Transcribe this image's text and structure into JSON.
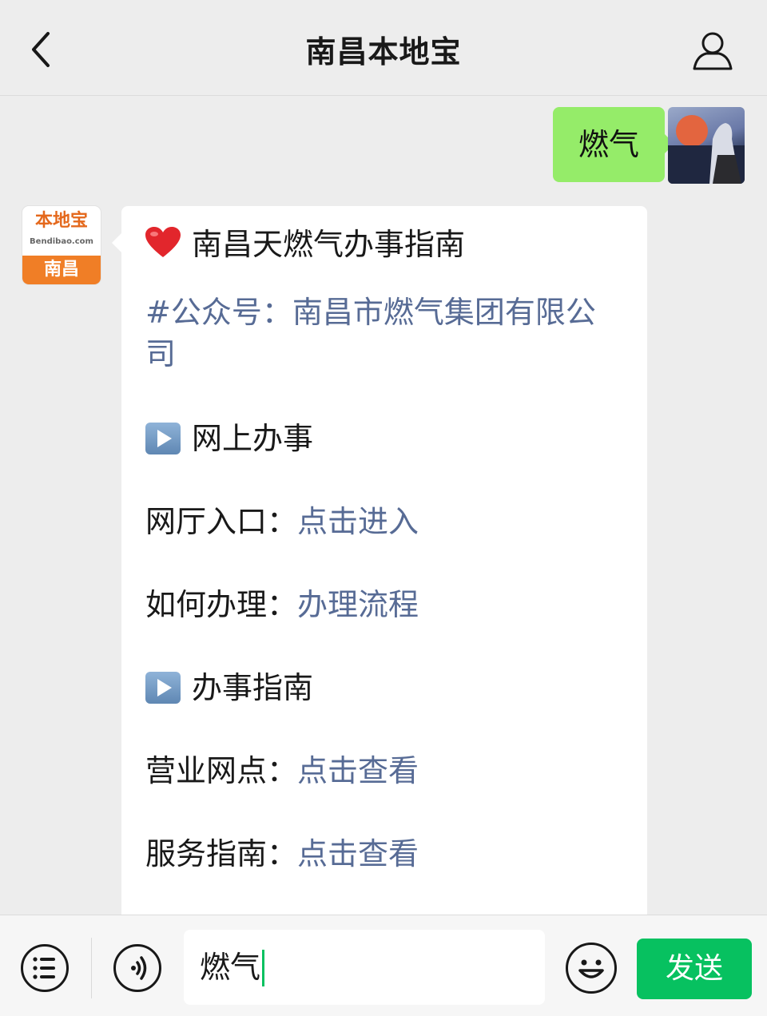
{
  "header": {
    "title": "南昌本地宝"
  },
  "outgoing_message": {
    "text": "燃气"
  },
  "bot_avatar": {
    "brand": "本地宝",
    "domain": "Bendibao.com",
    "city": "南昌"
  },
  "card": {
    "title": "南昌天燃气办事指南",
    "tag": "#公众号：南昌市燃气集团有限公司",
    "section1": {
      "label": "网上办事",
      "rows": [
        {
          "key": "网厅入口：",
          "link": "点击进入"
        },
        {
          "key": "如何办理：",
          "link": "办理流程"
        }
      ]
    },
    "section2": {
      "label": "办事指南",
      "rows": [
        {
          "key": "营业网点：",
          "link": "点击查看"
        },
        {
          "key": "服务指南：",
          "link": "点击查看"
        }
      ]
    }
  },
  "input_bar": {
    "value": "燃气",
    "send_label": "发送"
  },
  "colors": {
    "send": "#07c160",
    "bubble": "#95ec69",
    "link": "#576b95"
  },
  "icons": [
    "back-icon",
    "profile-icon",
    "heart-icon",
    "play-icon",
    "menu-icon",
    "voice-icon",
    "emoji-icon"
  ]
}
